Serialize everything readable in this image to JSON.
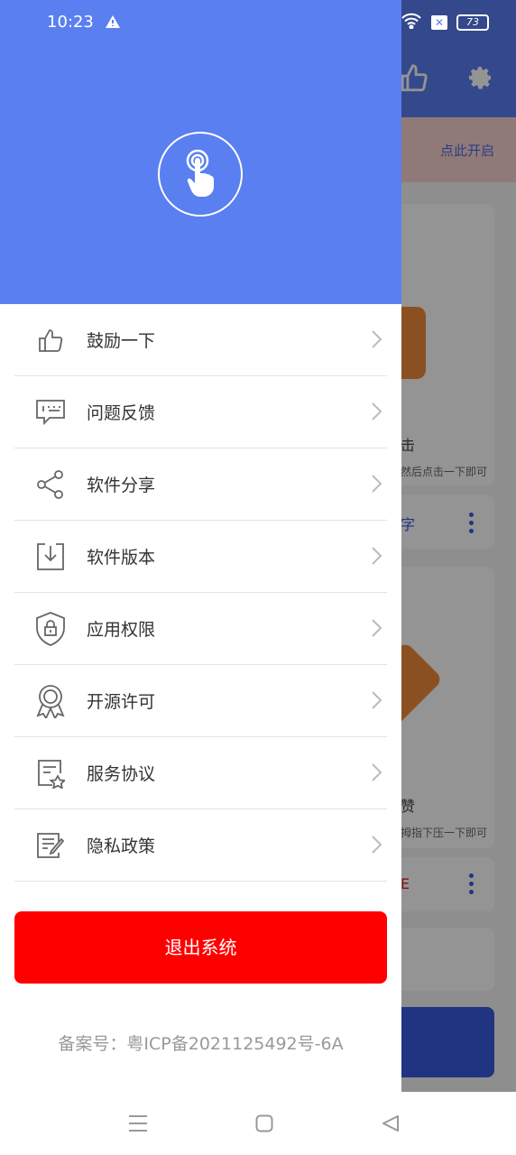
{
  "status_bar": {
    "time": "10:23",
    "battery": "73"
  },
  "background": {
    "banner_text": "点此开启",
    "card1_title": "击",
    "card1_desc": "然后点击一下即可",
    "card1_action": "字",
    "card2_title": "赞",
    "card2_desc": "拇指下压一下即可",
    "card2_action": "E"
  },
  "drawer": {
    "menu": [
      {
        "id": "encourage",
        "label": "鼓励一下",
        "icon": "thumbs-up-icon"
      },
      {
        "id": "feedback",
        "label": "问题反馈",
        "icon": "feedback-icon"
      },
      {
        "id": "share",
        "label": "软件分享",
        "icon": "share-icon"
      },
      {
        "id": "version",
        "label": "软件版本",
        "icon": "download-box-icon"
      },
      {
        "id": "permissions",
        "label": "应用权限",
        "icon": "shield-lock-icon"
      },
      {
        "id": "license",
        "label": "开源许可",
        "icon": "award-icon"
      },
      {
        "id": "agreement",
        "label": "服务协议",
        "icon": "document-star-icon"
      },
      {
        "id": "privacy",
        "label": "隐私政策",
        "icon": "document-edit-icon"
      }
    ],
    "logout_label": "退出系统",
    "icp": "备案号：粤ICP备2021125492号-6A"
  },
  "colors": {
    "header_blue": "#5a7ff0",
    "logout_red": "#ff0000"
  }
}
